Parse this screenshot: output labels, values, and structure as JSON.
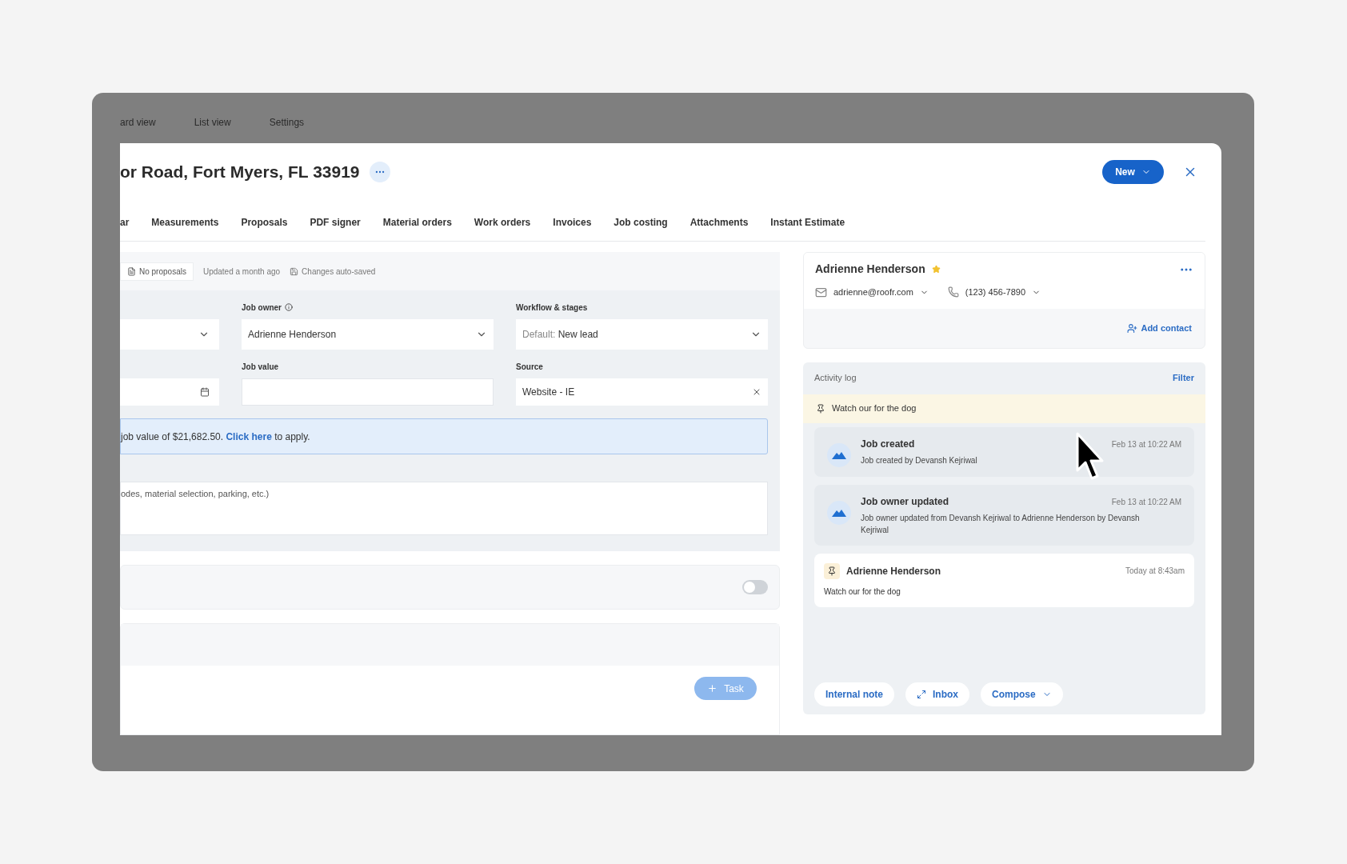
{
  "background": {
    "tabs": [
      "ard view",
      "List view",
      "Settings"
    ]
  },
  "modal": {
    "title": "or Road, Fort Myers, FL 33919",
    "new_button": "New",
    "tabs": [
      "ar",
      "Measurements",
      "Proposals",
      "PDF signer",
      "Material orders",
      "Work orders",
      "Invoices",
      "Job costing",
      "Attachments",
      "Instant Estimate"
    ]
  },
  "status": {
    "proposals": "No proposals",
    "updated": "Updated a month ago",
    "saved": "Changes auto-saved"
  },
  "form": {
    "job_owner": {
      "label": "Job owner",
      "value": "Adrienne Henderson"
    },
    "workflow": {
      "label": "Workflow & stages",
      "prefix": "Default:",
      "value": "New lead"
    },
    "job_value": {
      "label": "Job value"
    },
    "source": {
      "label": "Source",
      "value": "Website - IE"
    }
  },
  "suggestion": {
    "before": "job value of $21,682.50.",
    "link": "Click here",
    "after": "to apply."
  },
  "notes_placeholder": "odes, material selection, parking, etc.)",
  "toggle": {
    "on": false
  },
  "task_button": "Task",
  "contact": {
    "name": "Adrienne Henderson",
    "starred": true,
    "email": "adrienne@roofr.com",
    "phone": "(123) 456-7890",
    "add_contact": "Add contact"
  },
  "activity": {
    "title": "Activity log",
    "filter": "Filter",
    "pinned": "Watch our for the dog",
    "entries": [
      {
        "kind": "system",
        "title": "Job created",
        "time": "Feb 13 at 10:22 AM",
        "text": "Job created by Devansh Kejriwal"
      },
      {
        "kind": "system",
        "title": "Job owner updated",
        "time": "Feb 13 at 10:22 AM",
        "text": "Job owner updated from Devansh Kejriwal to Adrienne Henderson by Devansh Kejriwal"
      },
      {
        "kind": "note",
        "title": "Adrienne Henderson",
        "time": "Today at 8:43am",
        "text": "Watch our for the dog"
      }
    ],
    "actions": [
      {
        "label": "Internal note",
        "kind": "plain"
      },
      {
        "label": "Inbox",
        "kind": "expand"
      },
      {
        "label": "Compose",
        "kind": "menu"
      }
    ]
  }
}
